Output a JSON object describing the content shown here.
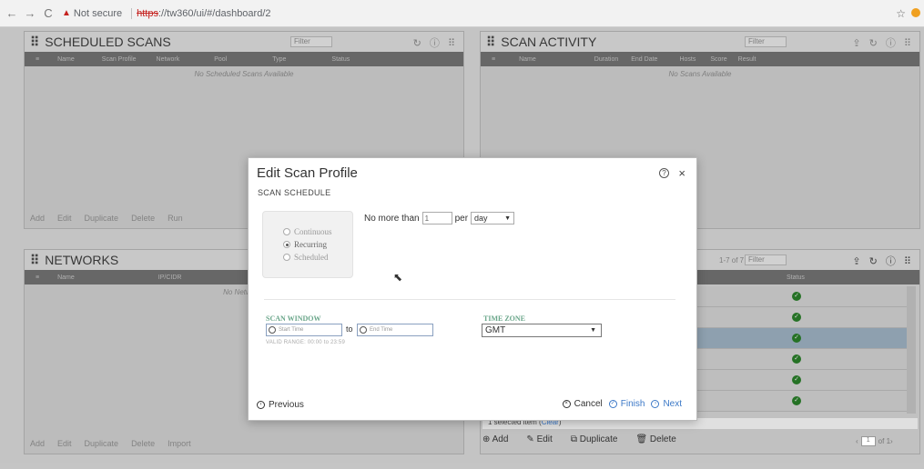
{
  "browser": {
    "not_secure": "Not secure",
    "url_scheme": "https",
    "url_rest": "://tw360/ui/#/dashboard/2"
  },
  "panels": {
    "scheduled_scans": {
      "title": "SCHEDULED SCANS",
      "columns": [
        "Name",
        "Scan Profile",
        "Network",
        "Pool",
        "Type",
        "Status"
      ],
      "empty_text": "No Scheduled Scans Available",
      "footer": [
        "Add",
        "Edit",
        "Duplicate",
        "Delete",
        "Run"
      ]
    },
    "scan_activity": {
      "title": "SCAN ACTIVITY",
      "columns": [
        "Name",
        "Duration",
        "End Date",
        "Hosts",
        "Score",
        "Result"
      ],
      "empty_text": "No Scans Available"
    },
    "networks": {
      "title": "NETWORKS",
      "columns": [
        "Name",
        "IP/CIDR"
      ],
      "empty_text": "No Networks",
      "footer": [
        "Add",
        "Edit",
        "Duplicate",
        "Delete",
        "Import"
      ]
    },
    "scan_profiles": {
      "count": "1-7 of 7",
      "column_status": "Status",
      "selected_info": "1 selected item",
      "clear_label": "Clear",
      "footer": [
        "Add",
        "Edit",
        "Duplicate",
        "Delete"
      ],
      "page": "1",
      "page_of": "of 1"
    }
  },
  "modal": {
    "title": "Edit Scan Profile",
    "subtitle": "SCAN SCHEDULE",
    "radios": [
      {
        "label": "Continuous",
        "checked": false
      },
      {
        "label": "Recurring",
        "checked": true
      },
      {
        "label": "Scheduled",
        "checked": false
      }
    ],
    "limit_prefix": "No more than",
    "limit_value": "1",
    "limit_per": "per",
    "limit_unit": "day",
    "scan_window_label": "SCAN WINDOW",
    "start_placeholder": "Start Time",
    "to_label": "to",
    "end_placeholder": "End Time",
    "valid_range": "VALID RANGE: 00:00 to 23:59",
    "time_zone_label": "TIME ZONE",
    "time_zone_value": "GMT",
    "previous": "Previous",
    "cancel": "Cancel",
    "finish": "Finish",
    "next": "Next"
  },
  "filter_placeholder": "Filter"
}
